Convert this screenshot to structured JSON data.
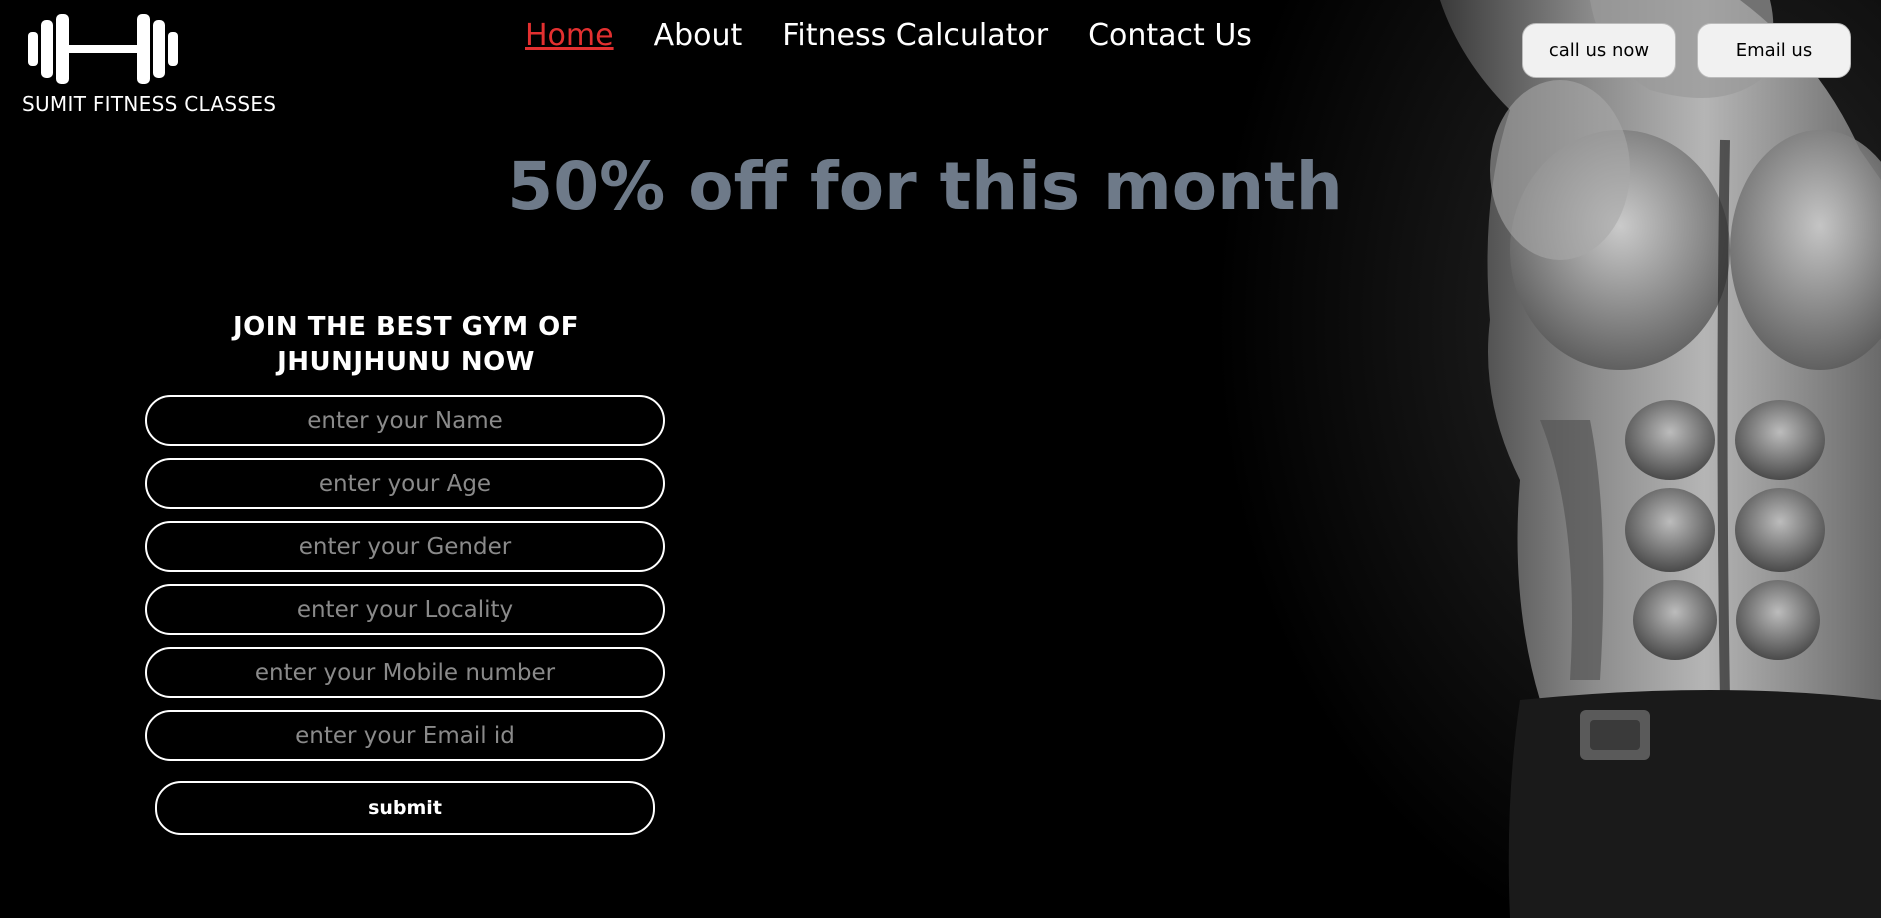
{
  "brand": {
    "name": "SUMIT FITNESS CLASSES",
    "logo_icon": "dumbbell-icon"
  },
  "nav": {
    "items": [
      {
        "label": "Home",
        "active": true
      },
      {
        "label": "About",
        "active": false
      },
      {
        "label": "Fitness Calculator",
        "active": false
      },
      {
        "label": "Contact Us",
        "active": false
      }
    ],
    "active_color": "#e33030"
  },
  "header_buttons": {
    "call_label": "call us now",
    "email_label": "Email us"
  },
  "promo": {
    "text": "50% off for this month",
    "color": "#6e7a89"
  },
  "form": {
    "title": "JOIN THE BEST GYM OF JHUNJHUNU NOW",
    "fields": [
      {
        "placeholder": "enter your Name",
        "value": ""
      },
      {
        "placeholder": "enter your Age",
        "value": ""
      },
      {
        "placeholder": "enter your Gender",
        "value": ""
      },
      {
        "placeholder": "enter your Locality",
        "value": ""
      },
      {
        "placeholder": "enter your Mobile number",
        "value": ""
      },
      {
        "placeholder": "enter your Email id",
        "value": ""
      }
    ],
    "submit_label": "submit"
  }
}
